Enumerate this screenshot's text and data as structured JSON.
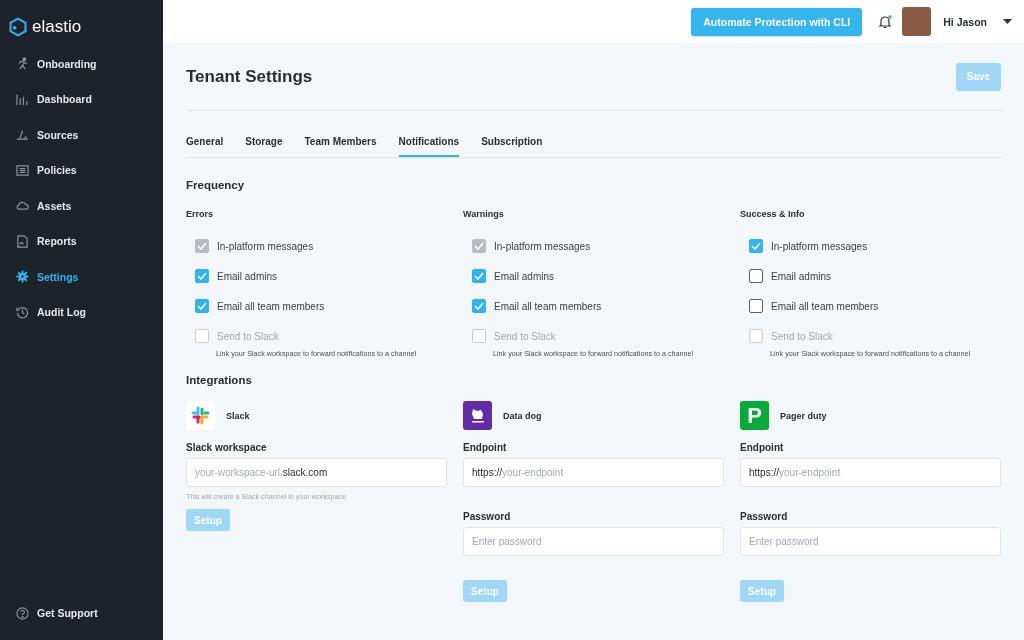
{
  "sidebar": {
    "logo": "elastio",
    "items": [
      {
        "label": "Onboarding",
        "selected": false
      },
      {
        "label": "Dashboard",
        "selected": false
      },
      {
        "label": "Sources",
        "selected": false
      },
      {
        "label": "Policies",
        "selected": false
      },
      {
        "label": "Assets",
        "selected": false
      },
      {
        "label": "Reports",
        "selected": false
      },
      {
        "label": "Settings",
        "selected": true
      },
      {
        "label": "Audit Log",
        "selected": false
      }
    ],
    "footer": {
      "label": "Get Support"
    }
  },
  "topbar": {
    "cli_button": "Automate Protection with CLI",
    "notifications_unread": true,
    "greeting": "Hi Jason"
  },
  "page": {
    "title": "Tenant Settings",
    "save_button": {
      "label": "Save",
      "disabled": true
    }
  },
  "tabs": [
    {
      "label": "General",
      "selected": false
    },
    {
      "label": "Storage",
      "selected": false
    },
    {
      "label": "Team Members",
      "selected": false
    },
    {
      "label": "Notifications",
      "selected": true
    },
    {
      "label": "Subscription",
      "selected": false
    }
  ],
  "frequency": {
    "heading": "Frequency",
    "groups": [
      {
        "title": "Errors",
        "options": [
          {
            "label": "In-platform messages",
            "checked": true,
            "disabled": true
          },
          {
            "label": "Email admins",
            "checked": true,
            "disabled": false
          },
          {
            "label": "Email all team members",
            "checked": true,
            "disabled": false
          },
          {
            "label": "Send to Slack",
            "checked": false,
            "disabled": true
          }
        ],
        "hint": "Link your Slack workspace to forward notifications to a channel"
      },
      {
        "title": "Warnings",
        "options": [
          {
            "label": "In-platform messages",
            "checked": true,
            "disabled": true
          },
          {
            "label": "Email admins",
            "checked": true,
            "disabled": false
          },
          {
            "label": "Email all team members",
            "checked": true,
            "disabled": false
          },
          {
            "label": "Send to Slack",
            "checked": false,
            "disabled": true
          }
        ],
        "hint": "Link your Slack workspace to forward notifications to a channel"
      },
      {
        "title": "Success & Info",
        "options": [
          {
            "label": "In-platform messages",
            "checked": true,
            "disabled": false
          },
          {
            "label": "Email admins",
            "checked": false,
            "disabled": false
          },
          {
            "label": "Email all team members",
            "checked": false,
            "disabled": false
          },
          {
            "label": "Send to Slack",
            "checked": false,
            "disabled": true
          }
        ],
        "hint": "Link your Slack workspace to forward notifications to a channel"
      }
    ]
  },
  "integrations": {
    "heading": "Integrations",
    "items": [
      {
        "kind": "slack",
        "name": "Slack",
        "fields": [
          {
            "label": "Slack workspace",
            "placeholder": "your-workspace-url.",
            "suffix": "slack.com",
            "note": "This will create a Slack channel in your workspace"
          }
        ],
        "setup": {
          "label": "Setup",
          "disabled": true
        }
      },
      {
        "kind": "datadog",
        "name": "Data dog",
        "fields": [
          {
            "label": "Endpoint",
            "prefix": "https://",
            "placeholder": "your-endpoint"
          },
          {
            "label": "Password",
            "placeholder": "Enter password"
          }
        ],
        "setup": {
          "label": "Setup",
          "disabled": true
        }
      },
      {
        "kind": "pagerduty",
        "name": "Pager duty",
        "logo_text": "P",
        "fields": [
          {
            "label": "Endpoint",
            "prefix": "https://",
            "placeholder": "your-endpoint"
          },
          {
            "label": "Password",
            "placeholder": "Enter password"
          }
        ],
        "setup": {
          "label": "Setup",
          "disabled": true
        }
      }
    ]
  }
}
